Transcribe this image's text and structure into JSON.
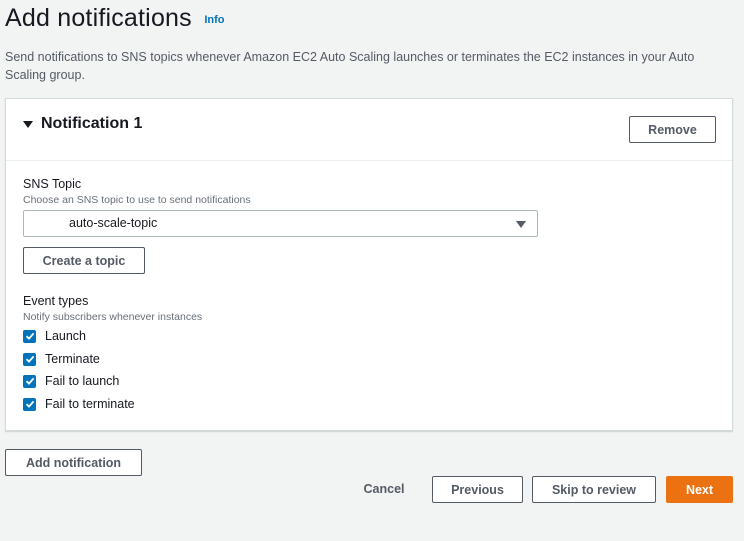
{
  "page": {
    "title": "Add notifications",
    "info_link": "Info",
    "description": "Send notifications to SNS topics whenever Amazon EC2 Auto Scaling launches or terminates the EC2 instances in your Auto Scaling group."
  },
  "notification": {
    "title": "Notification 1",
    "remove_label": "Remove",
    "sns_topic": {
      "label": "SNS Topic",
      "description": "Choose an SNS topic to use to send notifications",
      "selected_value": "auto-scale-topic",
      "create_label": "Create a topic"
    },
    "event_types": {
      "label": "Event types",
      "description": "Notify subscribers whenever instances",
      "options": [
        {
          "label": "Launch",
          "checked": true
        },
        {
          "label": "Terminate",
          "checked": true
        },
        {
          "label": "Fail to launch",
          "checked": true
        },
        {
          "label": "Fail to terminate",
          "checked": true
        }
      ]
    }
  },
  "actions": {
    "add_notification": "Add notification",
    "cancel": "Cancel",
    "previous": "Previous",
    "skip": "Skip to review",
    "next": "Next"
  },
  "colors": {
    "primary": "#ec7211",
    "link": "#0073bb",
    "checkbox": "#0073bb"
  },
  "icons": {
    "expand": "caret-down-icon",
    "dropdown": "chevron-down-icon",
    "check": "checkmark-icon"
  }
}
